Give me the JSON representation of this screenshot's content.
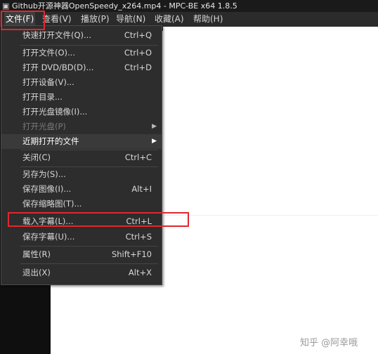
{
  "window": {
    "title": "Github开源神器OpenSpeedy_x264.mp4 - MPC-BE x64 1.8.5",
    "app_icon": "film-icon"
  },
  "menubar": [
    {
      "label": "文件(F)"
    },
    {
      "label": "查看(V)"
    },
    {
      "label": "播放(P)"
    },
    {
      "label": "导航(N)"
    },
    {
      "label": "收藏(A)"
    },
    {
      "label": "帮助(H)"
    }
  ],
  "file_menu": [
    {
      "label": "快速打开文件(Q)...",
      "shortcut": "Ctrl+Q"
    },
    {
      "label": "打开文件(O)...",
      "shortcut": "Ctrl+O"
    },
    {
      "label": "打开 DVD/BD(D)...",
      "shortcut": "Ctrl+D"
    },
    {
      "label": "打开设备(V)...",
      "shortcut": ""
    },
    {
      "label": "打开目录...",
      "shortcut": ""
    },
    {
      "label": "打开光盘镜像(I)...",
      "shortcut": ""
    },
    {
      "label": "打开光盘(P)",
      "shortcut": ""
    },
    {
      "label": "近期打开的文件",
      "shortcut": ""
    },
    {
      "label": "关闭(C)",
      "shortcut": "Ctrl+C"
    },
    {
      "label": "另存为(S)...",
      "shortcut": ""
    },
    {
      "label": "保存图像(I)...",
      "shortcut": "Alt+I"
    },
    {
      "label": "保存缩略图(T)...",
      "shortcut": ""
    },
    {
      "label": "载入字幕(L)...",
      "shortcut": "Ctrl+L"
    },
    {
      "label": "保存字幕(U)...",
      "shortcut": "Ctrl+S"
    },
    {
      "label": "属性(R)",
      "shortcut": "Shift+F10"
    },
    {
      "label": "退出(X)",
      "shortcut": "Alt+X"
    }
  ],
  "watermark": "知乎 @阿幸哦",
  "colors": {
    "menu_bg": "#2d2d2d",
    "highlight_box": "#e0282e",
    "disabled_text": "#7a7a7a"
  }
}
